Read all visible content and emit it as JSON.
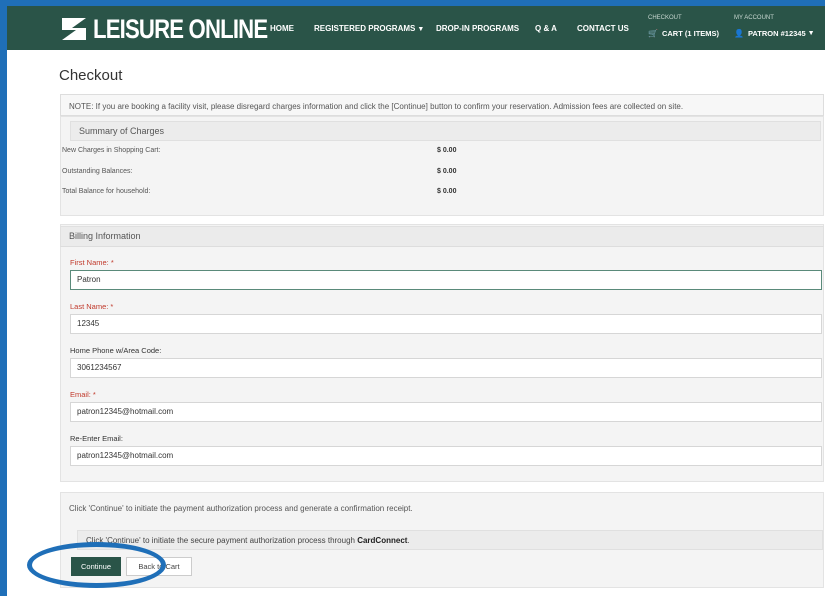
{
  "colors": {
    "nav_bg": "#2a5448",
    "frame": "#1f6fb8",
    "required": "#c0392b",
    "continue_bg": "#2a5448"
  },
  "nav": {
    "logo_text": "LEISURE ONLINE",
    "logo_icon": "swoosh-logo-icon",
    "home": "HOME",
    "registered_programs": "REGISTERED PROGRAMS",
    "dropin_programs": "DROP-IN PROGRAMS",
    "qa": "Q & A",
    "contact": "CONTACT US",
    "checkout_small": "CHECKOUT",
    "cart": "CART (1 ITEMS)",
    "myaccount_small": "MY ACCOUNT",
    "patron": "PATRON #12345"
  },
  "page_title": "Checkout",
  "note": "NOTE: If you are booking a facility visit, please disregard charges information and click the [Continue] button to confirm your reservation. Admission fees are collected on site.",
  "summary": {
    "heading": "Summary of Charges",
    "rows": [
      {
        "label": "New Charges in Shopping Cart:",
        "value": "$ 0.00"
      },
      {
        "label": "Outstanding Balances:",
        "value": "$ 0.00"
      },
      {
        "label": "Total Balance for household:",
        "value": "$ 0.00"
      }
    ]
  },
  "billing": {
    "heading": "Billing Information",
    "first_name_label": "First Name: *",
    "first_name_value": "Patron",
    "last_name_label": "Last Name: *",
    "last_name_value": "12345",
    "phone_label": "Home Phone w/Area Code:",
    "phone_value": "3061234567",
    "email_label": "Email: *",
    "email_value": "patron12345@hotmail.com",
    "reemail_label": "Re-Enter Email:",
    "reemail_value": "patron12345@hotmail.com"
  },
  "continue_section": {
    "note": "Click 'Continue' to initiate the payment authorization process and generate a confirmation receipt.",
    "card_note_prefix": "Click 'Continue' to initiate the secure payment authorization process through ",
    "card_note_brand": "CardConnect",
    "card_note_suffix": ".",
    "continue_label": "Continue",
    "back_label": "Back to Cart"
  }
}
